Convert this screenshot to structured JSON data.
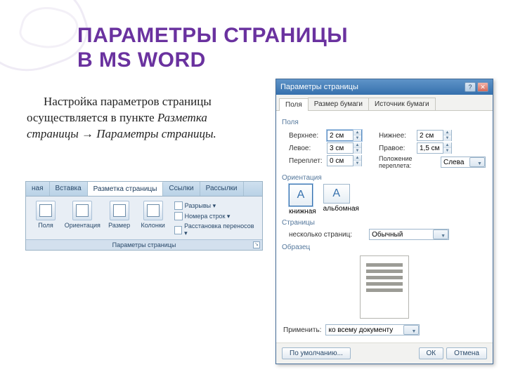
{
  "title_line1": "ПАРАМЕТРЫ СТРАНИЦЫ",
  "title_line2": "В MS WORD",
  "body": {
    "plain1": "Настройка параметров страницы осуществляется в пункте ",
    "italic1": "Разметка страницы",
    "arrow": " → ",
    "italic2": "Параметры страницы.",
    "period": ""
  },
  "ribbon": {
    "tabs": [
      "ная",
      "Вставка",
      "Разметка страницы",
      "Ссылки",
      "Рассылки"
    ],
    "active_tab_index": 2,
    "buttons": [
      {
        "label": "Поля"
      },
      {
        "label": "Ориентация"
      },
      {
        "label": "Размер"
      },
      {
        "label": "Колонки"
      }
    ],
    "small_items": [
      "Разрывы ▾",
      "Номера строк ▾",
      "Расстановка переносов ▾"
    ],
    "group_label": "Параметры страницы"
  },
  "dialog": {
    "title": "Параметры страницы",
    "tabs": [
      "Поля",
      "Размер бумаги",
      "Источник бумаги"
    ],
    "active_tab_index": 0,
    "sections": {
      "fields": "Поля",
      "orientation": "Ориентация",
      "pages": "Страницы",
      "sample": "Образец"
    },
    "field_labels": {
      "top": "Верхнее:",
      "left": "Левое:",
      "gutter": "Переплет:",
      "bottom": "Нижнее:",
      "right": "Правое:",
      "gutter_pos": "Положение переплета:"
    },
    "field_values": {
      "top": "2 см",
      "left": "3 см",
      "gutter": "0 см",
      "bottom": "2 см",
      "right": "1,5 см",
      "gutter_pos": "Слева"
    },
    "orientation": {
      "portrait": "книжная",
      "landscape": "альбомная"
    },
    "pages_label": "несколько страниц:",
    "pages_value": "Обычный",
    "apply_label": "Применить:",
    "apply_value": "ко всему документу",
    "buttons": {
      "default": "По умолчанию...",
      "ok": "ОК",
      "cancel": "Отмена"
    }
  }
}
